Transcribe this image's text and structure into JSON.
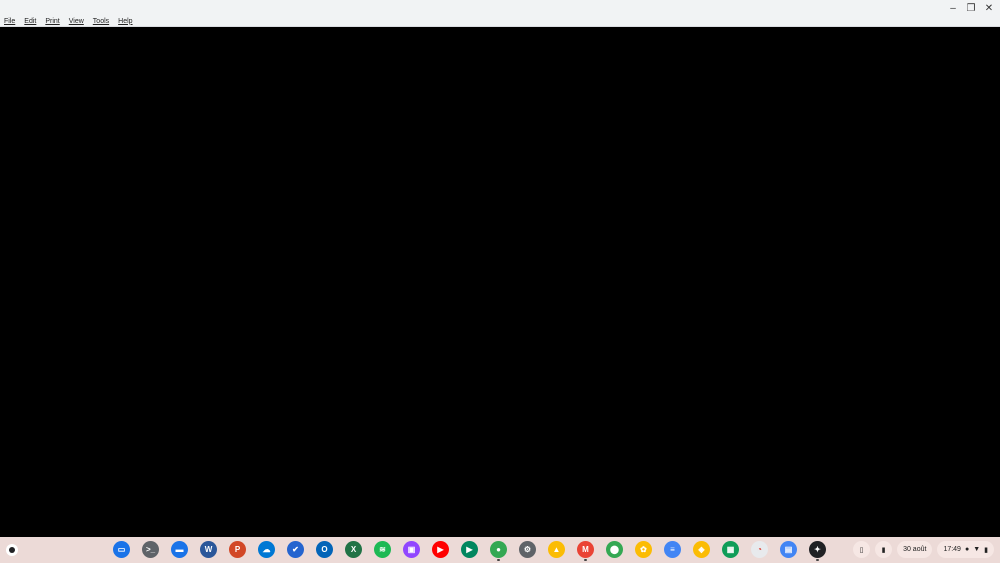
{
  "window": {
    "controls": {
      "minimize_glyph": "–",
      "restore_glyph": "❐",
      "close_glyph": "✕"
    }
  },
  "menu": {
    "items": [
      "File",
      "Edit",
      "Print",
      "View",
      "Tools",
      "Help"
    ]
  },
  "shelf": {
    "apps": [
      {
        "name": "messages-icon",
        "color": "#1a73e8",
        "glyph": "▭"
      },
      {
        "name": "terminal-icon",
        "color": "#5f6368",
        "glyph": ">_"
      },
      {
        "name": "files-icon",
        "color": "#1a73e8",
        "glyph": "▬"
      },
      {
        "name": "word-icon",
        "color": "#2b579a",
        "glyph": "W"
      },
      {
        "name": "powerpoint-icon",
        "color": "#d24726",
        "glyph": "P"
      },
      {
        "name": "onedrive-icon",
        "color": "#0078d4",
        "glyph": "☁"
      },
      {
        "name": "todo-icon",
        "color": "#2564cf",
        "glyph": "✔"
      },
      {
        "name": "outlook-icon",
        "color": "#0364b8",
        "glyph": "O"
      },
      {
        "name": "excel-icon",
        "color": "#217346",
        "glyph": "X"
      },
      {
        "name": "spotify-icon",
        "color": "#1db954",
        "glyph": "≋"
      },
      {
        "name": "twitch-icon",
        "color": "#9146ff",
        "glyph": "▣"
      },
      {
        "name": "youtube-icon",
        "color": "#ff0000",
        "glyph": "▶"
      },
      {
        "name": "play-store-icon",
        "color": "#01875f",
        "glyph": "▶"
      },
      {
        "name": "chrome-icon",
        "color": "#34a853",
        "glyph": "●",
        "running": true
      },
      {
        "name": "settings-icon",
        "color": "#5f6368",
        "glyph": "⚙"
      },
      {
        "name": "drive-icon",
        "color": "#fbbc04",
        "glyph": "▲"
      },
      {
        "name": "gmail-icon",
        "color": "#ea4335",
        "glyph": "M",
        "running": true
      },
      {
        "name": "maps-icon",
        "color": "#34a853",
        "glyph": "⬤"
      },
      {
        "name": "photos-icon",
        "color": "#fbbc04",
        "glyph": "✿"
      },
      {
        "name": "docs-icon",
        "color": "#4285f4",
        "glyph": "≡"
      },
      {
        "name": "keep-icon",
        "color": "#fbbc04",
        "glyph": "◈"
      },
      {
        "name": "sheets-icon",
        "color": "#0f9d58",
        "glyph": "▦"
      },
      {
        "name": "web-app-icon",
        "color": "#e8eaed",
        "glyph": "◔"
      },
      {
        "name": "calendar-icon",
        "color": "#4285f4",
        "glyph": "▤"
      },
      {
        "name": "pen-app-icon",
        "color": "#202124",
        "glyph": "✦",
        "running": true
      }
    ],
    "tray": {
      "date": "30 août",
      "time": "17:49"
    }
  }
}
